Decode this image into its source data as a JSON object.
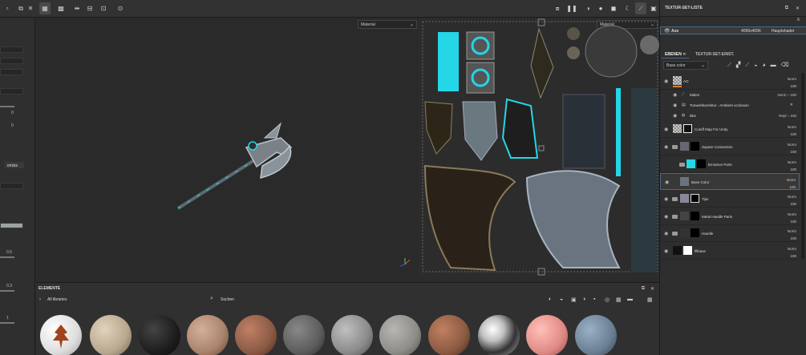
{
  "viewport": {
    "material_dropdown_3d": "Material",
    "material_dropdown_2d": "Material"
  },
  "left_panel": {
    "values": [
      "0",
      "0",
      "0.5",
      "0.3",
      "1"
    ],
    "emissive_label": "emiss"
  },
  "assets": {
    "title": "ELEMENTE",
    "library": "All libraries",
    "search_placeholder": "Suchen",
    "sphere_colors": [
      "#f2f2f2",
      "#b9a78f",
      "#1d1d1d",
      "#a9826a",
      "#8a5a44",
      "#5c5c5c",
      "#8a8a8a",
      "#8e8c86",
      "#8a5a42",
      "#c0c0c0",
      "#e08a84",
      "#6b7f94"
    ]
  },
  "texture_set_list": {
    "title": "TEXTUR-SET-LISTE",
    "set_name": "Axe",
    "resolution": "4096x4096",
    "shader": "Hauptshader"
  },
  "layers_panel": {
    "tab_layers": "EBENEN",
    "tab_settings": "TEXTUR-SET-EINST.",
    "channel": "Base color",
    "layers": [
      {
        "name": "AO",
        "blend": "Norm",
        "opacity": "100",
        "type": "fill"
      },
      {
        "name": "Malen",
        "blend": "Norm",
        "opacity": "100",
        "type": "sub"
      },
      {
        "name": "Tonwertkorrektur - Ambient occlusion",
        "blend": "",
        "opacity": "",
        "type": "sub"
      },
      {
        "name": "Blur",
        "blend": "Repl",
        "opacity": "100",
        "type": "sub"
      },
      {
        "name": "Cutoff Map For Unity",
        "blend": "Norm",
        "opacity": "100",
        "type": "fill"
      },
      {
        "name": "Square Connection",
        "blend": "Norm",
        "opacity": "100",
        "type": "folder"
      },
      {
        "name": "Emissive Parts",
        "blend": "Norm",
        "opacity": "100",
        "type": "folder"
      },
      {
        "name": "Base Color",
        "blend": "Norm",
        "opacity": "100",
        "type": "fill"
      },
      {
        "name": "Tips",
        "blend": "Norm",
        "opacity": "100",
        "type": "folder"
      },
      {
        "name": "Metal Handle Parts",
        "blend": "Norm",
        "opacity": "100",
        "type": "folder"
      },
      {
        "name": "Handle",
        "blend": "Norm",
        "opacity": "100",
        "type": "folder"
      },
      {
        "name": "fillbase",
        "blend": "Norm",
        "opacity": "100",
        "type": "fill"
      }
    ]
  },
  "colors": {
    "emissive": "#24d6e6",
    "selection": "#4a6a8a"
  }
}
